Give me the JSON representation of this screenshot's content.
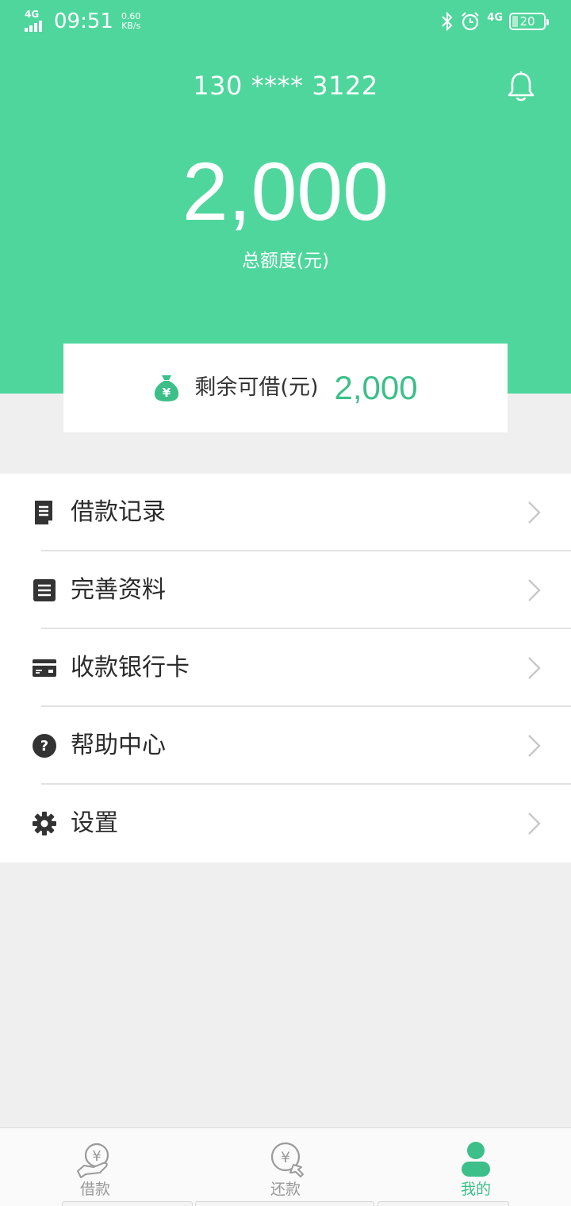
{
  "status_bar": {
    "network_tag": "4G",
    "time": "09:51",
    "speed_value": "0.60",
    "speed_unit": "KB/s",
    "right_network": "4G",
    "battery": "20"
  },
  "header": {
    "phone": "130 **** 3122",
    "credit_total": "2,000",
    "credit_label": "总额度(元)",
    "brand_color": "#4fd69c"
  },
  "available": {
    "label": "剩余可借(元)",
    "value": "2,000",
    "icon": "money-bag-icon",
    "accent_color": "#3cbf89"
  },
  "menu": {
    "items": [
      {
        "label": "借款记录",
        "icon": "document-icon"
      },
      {
        "label": "完善资料",
        "icon": "list-icon"
      },
      {
        "label": "收款银行卡",
        "icon": "bank-card-icon"
      },
      {
        "label": "帮助中心",
        "icon": "help-icon"
      },
      {
        "label": "设置",
        "icon": "gear-icon"
      }
    ]
  },
  "tabbar": {
    "tabs": [
      {
        "label": "借款",
        "icon": "borrow-icon",
        "active": false
      },
      {
        "label": "还款",
        "icon": "repay-icon",
        "active": false
      },
      {
        "label": "我的",
        "icon": "profile-icon",
        "active": true
      }
    ]
  }
}
